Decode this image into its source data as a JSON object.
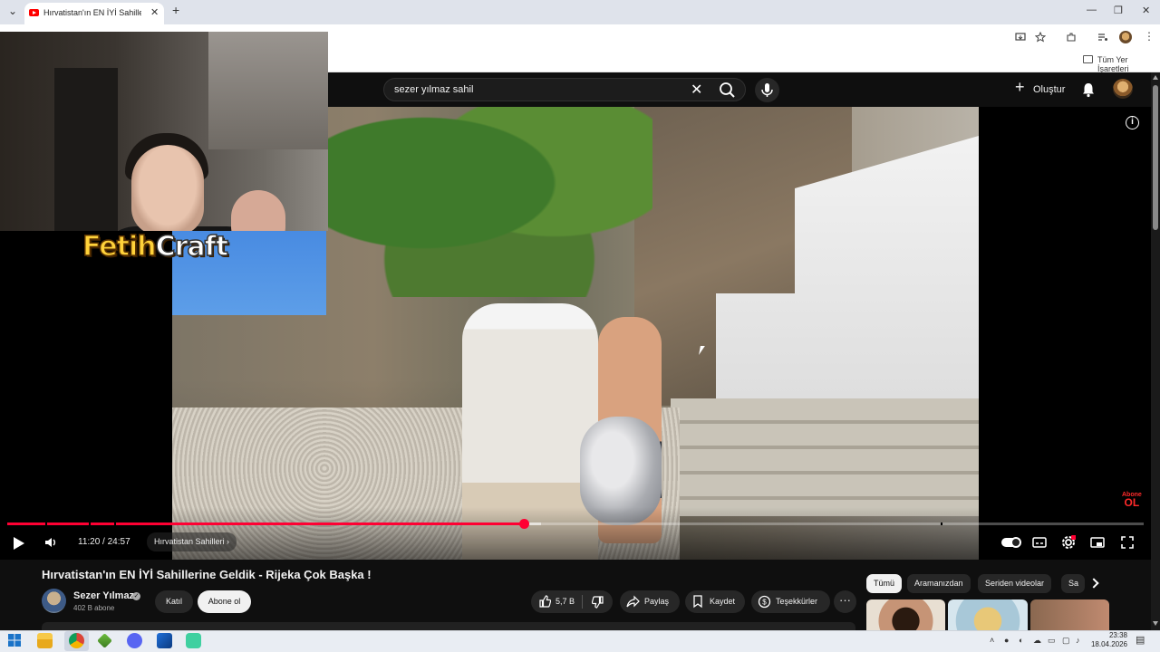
{
  "browser": {
    "tab_title": "Hırvatistan'ın EN İYİ Sahillerine Geldik - Rijeka Çok Başka !",
    "tab_close": "✕",
    "new_tab": "+",
    "tab_list": "⌄",
    "window_minimize": "—",
    "window_restore": "❐",
    "window_close": "✕",
    "bookmarks_folder_label": "Tüm Yer İşaretleri"
  },
  "youtube": {
    "search_value": "sezer yılmaz sahil",
    "create_label": "Oluştur",
    "info_symbol": "i",
    "abone_badge_top": "Abone",
    "abone_badge_bottom": "OL"
  },
  "overlay": {
    "logo_part1": "Fetih",
    "logo_part2": "Craft"
  },
  "player": {
    "time_display": "11:20 / 24:57",
    "chapter_label": "Hırvatistan Sahilleri ›",
    "progress_fraction": 0.4543,
    "buffered_fraction": 0.47
  },
  "video": {
    "title": "Hırvatistan'ın EN İYİ Sahillerine Geldik - Rijeka Çok Başka !",
    "channel_name": "Sezer Yılmaz",
    "verified_mark": "✓",
    "subscribers": "402 B abone",
    "join_label": "Katıl",
    "subscribe_label": "Abone ol",
    "like_count": "5,7 B",
    "share_label": "Paylaş",
    "save_label": "Kaydet",
    "thanks_label": "Teşekkürler",
    "more_label": "···"
  },
  "chips": [
    "Tümü",
    "Aramanızdan",
    "Seriden videolar",
    "Sa"
  ],
  "taskbar": {
    "time": "23:38",
    "date": "18.04.2026"
  },
  "colors": {
    "accent_red": "#ff0033",
    "yt_bg": "#0f0f0f",
    "logo_yellow": "#ffd23a"
  }
}
